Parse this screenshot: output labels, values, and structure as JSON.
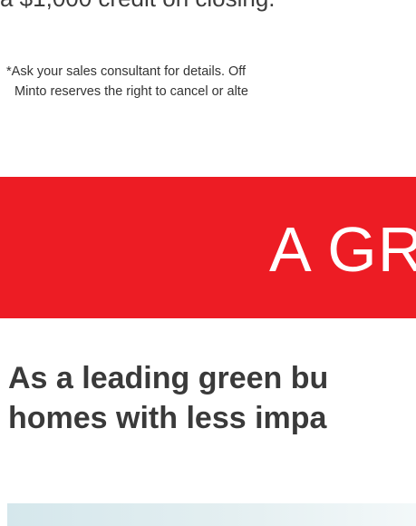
{
  "offer": {
    "top_line": "a $1,000 credit on closing.",
    "disclaimer_line1": "*Ask your sales consultant for details. Off",
    "disclaimer_line2": "Minto reserves the right to cancel or alte"
  },
  "banner": {
    "title": "A GR",
    "color": "#ed1c24"
  },
  "intro": {
    "line1": "As a leading green bu",
    "line2": "homes with less impa"
  }
}
